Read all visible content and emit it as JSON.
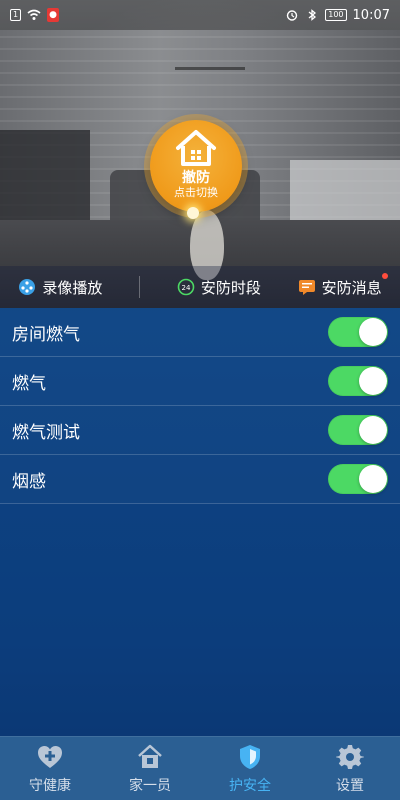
{
  "status_bar": {
    "time": "10:07",
    "battery": "100",
    "left_badge": "1"
  },
  "hero": {
    "mode": {
      "title": "撤防",
      "subtitle": "点击切换"
    },
    "actions": [
      {
        "label": "录像播放",
        "icon": "film-reel-icon"
      },
      {
        "label": "安防时段",
        "icon": "clock-24-icon"
      },
      {
        "label": "安防消息",
        "icon": "message-icon",
        "has_notification": true
      }
    ]
  },
  "sensors": [
    {
      "label": "房间燃气",
      "enabled": true
    },
    {
      "label": "燃气",
      "enabled": true
    },
    {
      "label": "燃气测试",
      "enabled": true
    },
    {
      "label": "烟感",
      "enabled": true
    }
  ],
  "tabs": [
    {
      "label": "守健康",
      "icon": "heart-plus-icon",
      "active": false
    },
    {
      "label": "家一员",
      "icon": "house-icon",
      "active": false
    },
    {
      "label": "护安全",
      "icon": "shield-icon",
      "active": true
    },
    {
      "label": "设置",
      "icon": "gear-icon",
      "active": false
    }
  ],
  "colors": {
    "accent_blue": "#47b3f3",
    "switch_on": "#4cd964",
    "mode_orange": "#f09a1a",
    "tab_bar_bg": "#2b5f93"
  }
}
